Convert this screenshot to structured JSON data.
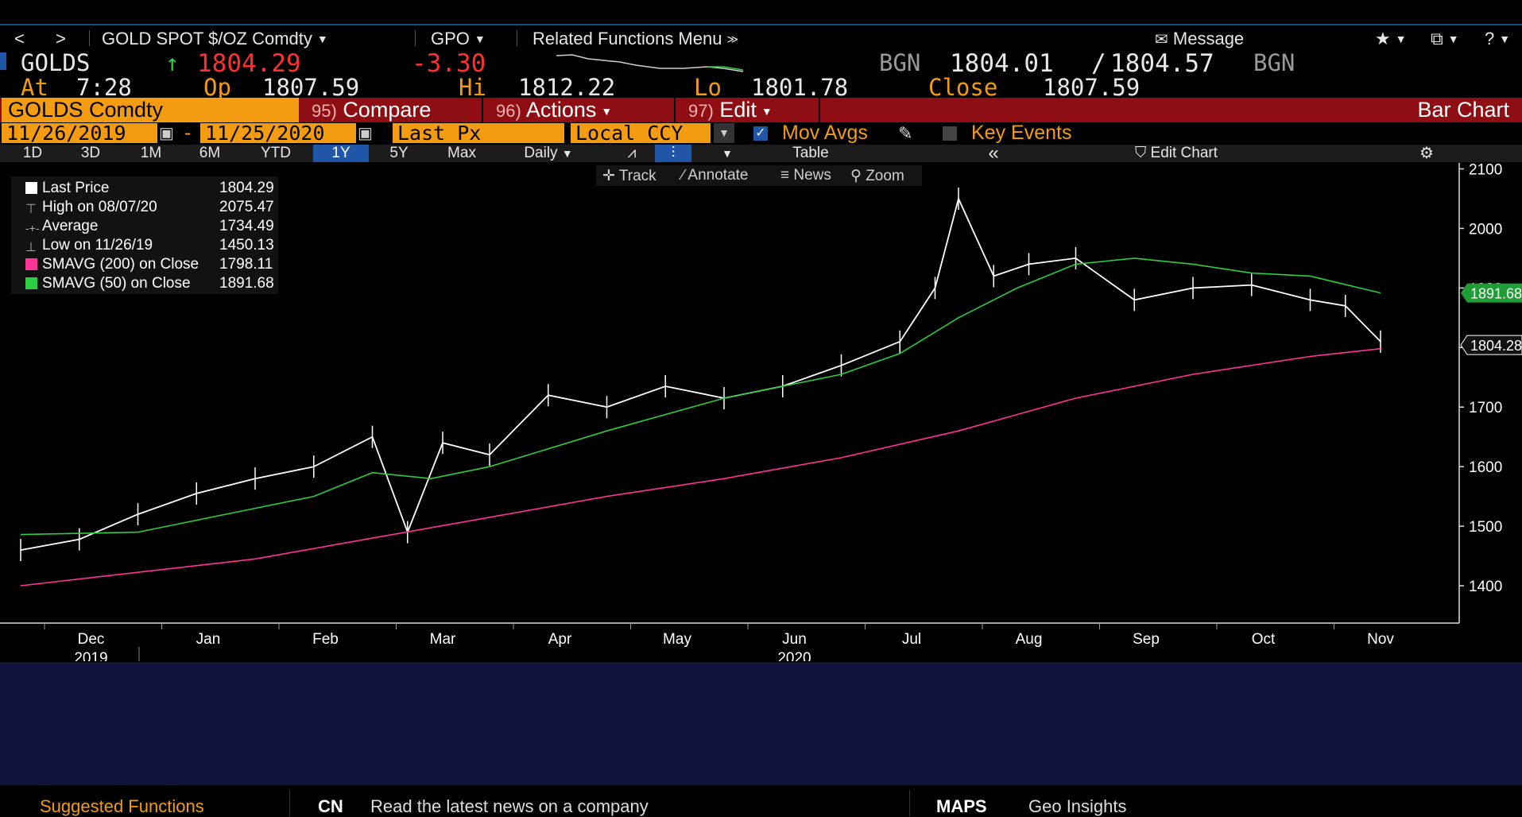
{
  "nav": {
    "back": "<",
    "forward": ">",
    "security": "GOLD SPOT $/OZ Comdty",
    "source": "GPO",
    "related": "Related Functions Menu",
    "message": "Message",
    "help": "?"
  },
  "quote": {
    "ticker": "GOLDS",
    "last": "1804.29",
    "change": "-3.30",
    "bid_source": "BGN",
    "bid": "1804.01",
    "ask": "1804.57",
    "ask_source": "BGN",
    "at_label": "At",
    "time": "7:28",
    "op_label": "Op",
    "open": "1807.59",
    "hi_label": "Hi",
    "high": "1812.22",
    "lo_label": "Lo",
    "low": "1801.78",
    "close_label": "Close",
    "close": "1807.59"
  },
  "funcbar": {
    "security_field": "GOLDS Comdty",
    "compare_num": "95)",
    "compare": "Compare",
    "actions_num": "96)",
    "actions": "Actions",
    "edit_num": "97)",
    "edit": "Edit",
    "chart_type": "Bar Chart"
  },
  "datebar": {
    "start_date": "11/26/2019",
    "end_date": "11/25/2020",
    "separator": "-",
    "field": "Last Px",
    "currency": "Local CCY",
    "mov_avgs": "Mov Avgs",
    "key_events": "Key Events"
  },
  "rangebar": {
    "ranges": [
      "1D",
      "3D",
      "1M",
      "6M",
      "YTD",
      "1Y",
      "5Y",
      "Max"
    ],
    "selected": "1Y",
    "frequency": "Daily",
    "table": "Table",
    "edit_chart": "Edit Chart"
  },
  "tools": {
    "track": "Track",
    "annotate": "Annotate",
    "news": "News",
    "zoom": "Zoom"
  },
  "legend": [
    {
      "label": "Last Price",
      "value": "1804.29",
      "color": "#ffffff",
      "marker": "square"
    },
    {
      "label": "High on 08/07/20",
      "value": "2075.47",
      "color": "#aaaaaa",
      "marker": "high"
    },
    {
      "label": "Average",
      "value": "1734.49",
      "color": "#aaaaaa",
      "marker": "avg"
    },
    {
      "label": "Low on 11/26/19",
      "value": "1450.13",
      "color": "#aaaaaa",
      "marker": "low"
    },
    {
      "label": "SMAVG (200)  on Close",
      "value": "1798.11",
      "color": "#ff3399",
      "marker": "square"
    },
    {
      "label": "SMAVG (50)  on Close",
      "value": "1891.68",
      "color": "#2ecc40",
      "marker": "square"
    }
  ],
  "chart_data": {
    "type": "line",
    "title": "",
    "xlabel": "",
    "ylabel": "",
    "ylim": [
      1340,
      2110
    ],
    "yticks": [
      1400,
      1500,
      1600,
      1700,
      1800,
      1900,
      2000,
      2100
    ],
    "x_month_labels": [
      "Dec",
      "Jan",
      "Feb",
      "Mar",
      "Apr",
      "May",
      "Jun",
      "Jul",
      "Aug",
      "Sep",
      "Oct",
      "Nov"
    ],
    "x_year_labels": [
      "2019",
      "2020"
    ],
    "x_index_range": [
      0,
      12
    ],
    "series": [
      {
        "name": "Last Price",
        "color": "#ffffff",
        "x": [
          0,
          0.5,
          1.0,
          1.5,
          2.0,
          2.5,
          3.0,
          3.3,
          3.6,
          4.0,
          4.5,
          5.0,
          5.5,
          6.0,
          6.5,
          7.0,
          7.5,
          7.8,
          8.0,
          8.3,
          8.6,
          9.0,
          9.5,
          10.0,
          10.5,
          11.0,
          11.3,
          11.6
        ],
        "y": [
          1460,
          1478,
          1520,
          1555,
          1580,
          1600,
          1650,
          1490,
          1640,
          1620,
          1720,
          1700,
          1735,
          1715,
          1735,
          1770,
          1810,
          1900,
          2050,
          1920,
          1940,
          1950,
          1880,
          1900,
          1905,
          1880,
          1870,
          1810
        ]
      },
      {
        "name": "SMAVG (50)",
        "color": "#2ecc40",
        "x": [
          0,
          1.0,
          2.0,
          2.5,
          3.0,
          3.5,
          4.0,
          5.0,
          6.0,
          7.0,
          7.5,
          8.0,
          8.5,
          9.0,
          9.5,
          10.0,
          10.5,
          11.0,
          11.6
        ],
        "y": [
          1486,
          1490,
          1530,
          1550,
          1590,
          1580,
          1600,
          1660,
          1715,
          1755,
          1790,
          1850,
          1900,
          1940,
          1950,
          1940,
          1925,
          1920,
          1891.68
        ]
      },
      {
        "name": "SMAVG (200)",
        "color": "#ff3399",
        "x": [
          0,
          2.0,
          3.0,
          4.0,
          5.0,
          6.0,
          7.0,
          8.0,
          9.0,
          10.0,
          11.0,
          11.6
        ],
        "y": [
          1400,
          1445,
          1480,
          1515,
          1550,
          1580,
          1615,
          1660,
          1715,
          1755,
          1785,
          1798.11
        ]
      }
    ],
    "price_labels": {
      "sma50": "1891.68",
      "last": "1804.28"
    }
  },
  "footer": {
    "suggested": "Suggested Functions",
    "cn_code": "CN",
    "cn_text": "Read the latest news on a company",
    "maps_code": "MAPS",
    "maps_text": "Geo Insights"
  }
}
